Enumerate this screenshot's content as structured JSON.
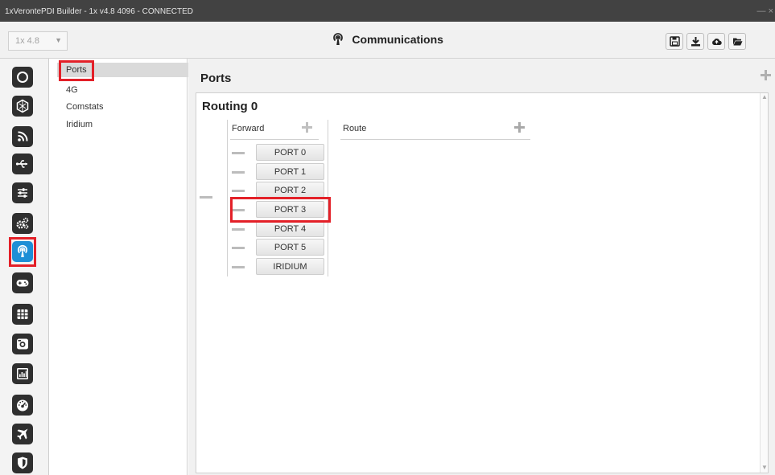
{
  "window": {
    "title": "1xVerontePDI Builder - 1x v4.8 4096 - CONNECTED",
    "controls": "— ×"
  },
  "toolbar": {
    "version_select": "1x 4.8",
    "version_caret": "▼",
    "page_title": "Communications",
    "buttons": [
      "save-icon",
      "download-icon",
      "cloud-upload-icon",
      "folder-open-icon"
    ]
  },
  "sidebar": {
    "active": "communications",
    "items": [
      "power-icon",
      "network-icon",
      "rss-icon",
      "usb-icon",
      "sliders-icon",
      "cogs-icon",
      "communications-icon",
      "gamepad-icon",
      "grid-icon",
      "camera-icon",
      "chart-icon",
      "dashboard-icon",
      "plane-icon",
      "shield-icon"
    ]
  },
  "subnav": {
    "selected": "Ports",
    "items": [
      "Ports",
      "4G",
      "Comstats",
      "Iridium"
    ]
  },
  "main": {
    "section_title": "Ports",
    "routing": {
      "title": "Routing 0",
      "forward_label": "Forward",
      "route_label": "Route",
      "ports": [
        "PORT 0",
        "PORT 1",
        "PORT 2",
        "PORT 3",
        "PORT 4",
        "PORT 5",
        "IRIDIUM"
      ],
      "highlighted_port": "PORT 3"
    }
  },
  "colors": {
    "highlight": "#e32028",
    "active_nav": "#1d8fd6",
    "titlebar": "#424242"
  }
}
